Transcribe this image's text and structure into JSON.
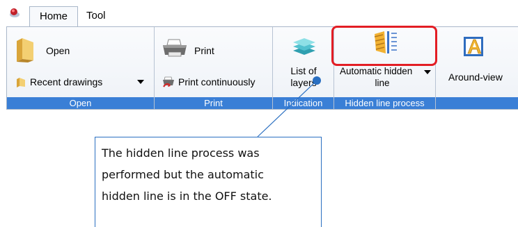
{
  "tabs": {
    "home": "Home",
    "tool": "Tool"
  },
  "open_group": {
    "open_label": "Open",
    "recent_label": "Recent drawings",
    "group_label": "Open"
  },
  "print_group": {
    "print_label": "Print",
    "print_continuously_label": "Print continuously",
    "group_label": "Print"
  },
  "indication_group": {
    "list_of_layers_line1": "List of",
    "list_of_layers_line2": "layers",
    "group_label": "Indication"
  },
  "hidden_line_group": {
    "auto_hidden_line1": "Automatic hidden",
    "auto_hidden_line2": "line",
    "group_label": "Hidden line process"
  },
  "around_view": {
    "label": "Around-view"
  },
  "callout": {
    "line1": "The hidden line process was",
    "line2": "performed but the automatic",
    "line3": "hidden line is in the OFF state."
  },
  "colors": {
    "group_bar": "#3a7fd6",
    "highlight": "#e31d24",
    "callout": "#2a6fc1"
  }
}
